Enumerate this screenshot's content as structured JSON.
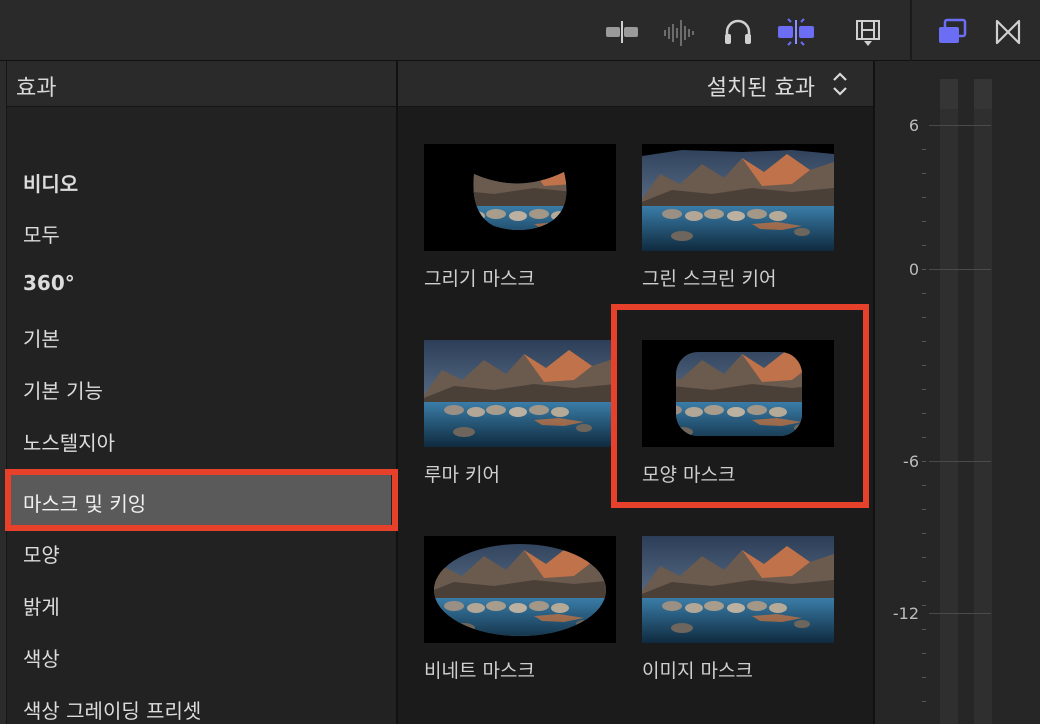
{
  "toolbar": {
    "icons": [
      "clip-appearance-icon",
      "audio-waveform-icon",
      "headphones-icon",
      "skimming-icon",
      "filmstrip-icon",
      "window-layout-icon",
      "transitions-icon"
    ],
    "accent": "#6b6ef5"
  },
  "sidebar": {
    "title": "효과",
    "heading": "비디오",
    "items": [
      "모두",
      "360°",
      "기본",
      "기본 기능",
      "노스텔지아",
      "마스크 및 키잉",
      "모양",
      "밝게",
      "색상",
      "색상 그레이딩 프리셋"
    ],
    "selected": "마스크 및 키잉"
  },
  "browser": {
    "filter_label": "설치된 효과",
    "effects": [
      {
        "label": "그리기 마스크"
      },
      {
        "label": "그린 스크린 키어"
      },
      {
        "label": "루마 키어"
      },
      {
        "label": "모양 마스크"
      },
      {
        "label": "비네트 마스크"
      },
      {
        "label": "이미지 마스크"
      }
    ],
    "highlighted": "모양 마스크"
  },
  "meter": {
    "labels": [
      "6",
      "0",
      "-6",
      "-12"
    ]
  },
  "colors": {
    "highlight_red": "#e8412b",
    "selected_bg": "#5a5a5a",
    "toolbar_accent": "#6b6ef5"
  }
}
